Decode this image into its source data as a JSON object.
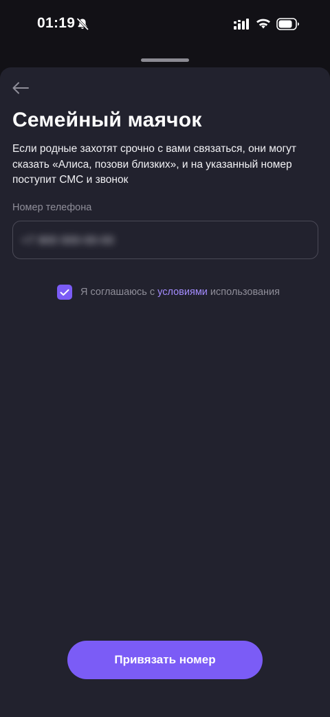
{
  "status_bar": {
    "time": "01:19"
  },
  "header": {
    "title": "Семейный маячок",
    "description": "Если родные захотят срочно с вами связаться, они могут сказать «Алиса, позови близких», и на указанный номер поступит СМС и звонок"
  },
  "phone": {
    "label": "Номер телефона",
    "value": "+7 900 000-00-00"
  },
  "terms": {
    "checked": true,
    "text_before": "Я соглашаюсь с ",
    "link_text": "условиями",
    "text_after": " использования"
  },
  "actions": {
    "primary_label": "Привязать номер"
  },
  "icons": {
    "status": [
      "bell-muted-icon",
      "signal-icon",
      "wifi-icon",
      "battery-icon"
    ],
    "back": "arrow-left-icon",
    "check": "checkmark-icon"
  },
  "colors": {
    "background": "#121116",
    "sheet": "#22222e",
    "accent": "#7b5cf6",
    "link": "#a48cff",
    "muted_text": "#8f8e99"
  }
}
